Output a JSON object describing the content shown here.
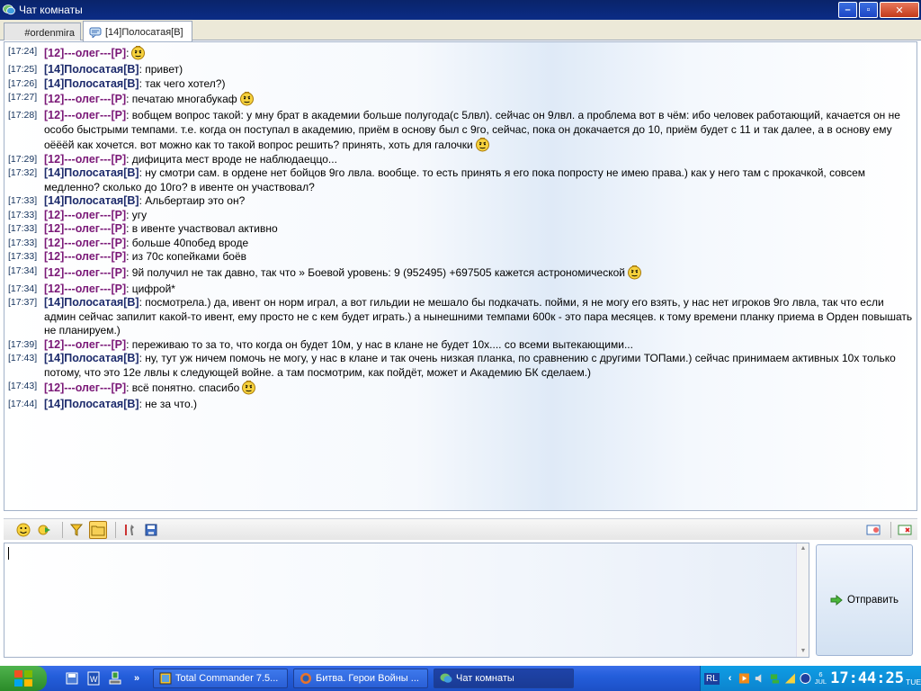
{
  "window": {
    "title": "Чат комнаты",
    "minimize": "–",
    "maximize": "▫",
    "close": "✕"
  },
  "tabs": [
    {
      "label": "#ordenmira"
    },
    {
      "label": "[14]Полосатая[B]"
    }
  ],
  "messages": [
    {
      "time": "[17:24]",
      "nick": "[12]---олег---[P]",
      "text": ":",
      "smile": true
    },
    {
      "time": "[17:25]",
      "nick": "[14]Полосатая[B]",
      "text": ": привет)",
      "smile": false
    },
    {
      "time": "[17:26]",
      "nick": "[14]Полосатая[B]",
      "text": ": так чего хотел?)",
      "smile": false
    },
    {
      "time": "[17:27]",
      "nick": "[12]---олег---[P]",
      "text": ": печатаю многабукаф",
      "smile": true
    },
    {
      "time": "[17:28]",
      "nick": "[12]---олег---[P]",
      "text": ": вобщем вопрос такой: у мну брат в академии больше полугода(с 5лвл). сейчас он 9лвл. а проблема вот в чём: ибо человек работающий, качается он не особо быстрыми темпами. т.е. когда он поступал в академию, приём в основу был с 9го, сейчас, пока он докачается до 10, приём будет с 11 и так далее, а в основу ему оёёёй как хочется. вот можно как то такой вопрос решить? принять, хоть для галочки",
      "smile": true
    },
    {
      "time": "[17:29]",
      "nick": "[12]---олег---[P]",
      "text": ": дифицита мест вроде не наблюдаеццо...",
      "smile": false
    },
    {
      "time": "[17:32]",
      "nick": "[14]Полосатая[B]",
      "text": ": ну смотри сам. в ордене нет бойцов 9го лвла. вообще. то есть принять я его пока попросту не имею права.) как у него там с прокачкой, совсем медленно? сколько до 10го? в ивенте он участвовал?",
      "smile": false
    },
    {
      "time": "[17:33]",
      "nick": "[14]Полосатая[B]",
      "text": ": Альбертаир  это он?",
      "smile": false
    },
    {
      "time": "[17:33]",
      "nick": "[12]---олег---[P]",
      "text": ": угу",
      "smile": false
    },
    {
      "time": "[17:33]",
      "nick": "[12]---олег---[P]",
      "text": ": в ивенте участвовал активно",
      "smile": false
    },
    {
      "time": "[17:33]",
      "nick": "[12]---олег---[P]",
      "text": ": больше 40побед вроде",
      "smile": false
    },
    {
      "time": "[17:33]",
      "nick": "[12]---олег---[P]",
      "text": ": из 70с копейками боёв",
      "smile": false
    },
    {
      "time": "[17:34]",
      "nick": "[12]---олег---[P]",
      "text": ": 9й получил не так давно, так что  » Боевой уровень: 9 (952495) +697505 кажется астрономической",
      "smile": true
    },
    {
      "time": "[17:34]",
      "nick": "[12]---олег---[P]",
      "text": ": цифрой*",
      "smile": false
    },
    {
      "time": "[17:37]",
      "nick": "[14]Полосатая[B]",
      "text": ": посмотрела.) да, ивент он норм играл, а вот гильдии не мешало бы подкачать. пойми, я не могу его взять, у нас нет игроков 9го лвла, так что если админ сейчас запилит какой-то ивент, ему просто не с кем будет играть.) а нынешними темпами 600к - это пара месяцев. к тому времени планку приема в Орден повышать не планируем.)",
      "smile": false
    },
    {
      "time": "[17:39]",
      "nick": "[12]---олег---[P]",
      "text": ": переживаю то за то, что когда он будет 10м, у нас в клане не будет 10х.... со всеми вытекающими...",
      "smile": false
    },
    {
      "time": "[17:43]",
      "nick": "[14]Полосатая[B]",
      "text": ": ну, тут уж ничем помочь не могу, у нас в клане и так очень низкая планка, по сравнению с другими ТОПами.) сейчас принимаем активных 10х только потому, что это 12е лвлы к следующей войне. а там посмотрим, как пойдёт, может и Академию БК сделаем.)",
      "smile": false
    },
    {
      "time": "[17:43]",
      "nick": "[12]---олег---[P]",
      "text": ": всё понятно. спасибо",
      "smile": true
    },
    {
      "time": "[17:44]",
      "nick": "[14]Полосатая[B]",
      "text": ": не за что.)",
      "smile": false
    }
  ],
  "composer": {
    "send_label": "Отправить",
    "value": ""
  },
  "taskbar": {
    "tasks": [
      {
        "label": "Total Commander 7.5..."
      },
      {
        "label": "Битва. Герои Войны ..."
      },
      {
        "label": "Чат комнаты"
      }
    ],
    "tray": {
      "lang": "RL",
      "date_day": "6",
      "date_month": "JUL",
      "time": "17:44:25",
      "weekday": "TUE"
    }
  },
  "colors": {
    "nick_oleg": "#7a1877",
    "nick_polosataya": "#1c2a6b",
    "accent": "#245edb"
  }
}
